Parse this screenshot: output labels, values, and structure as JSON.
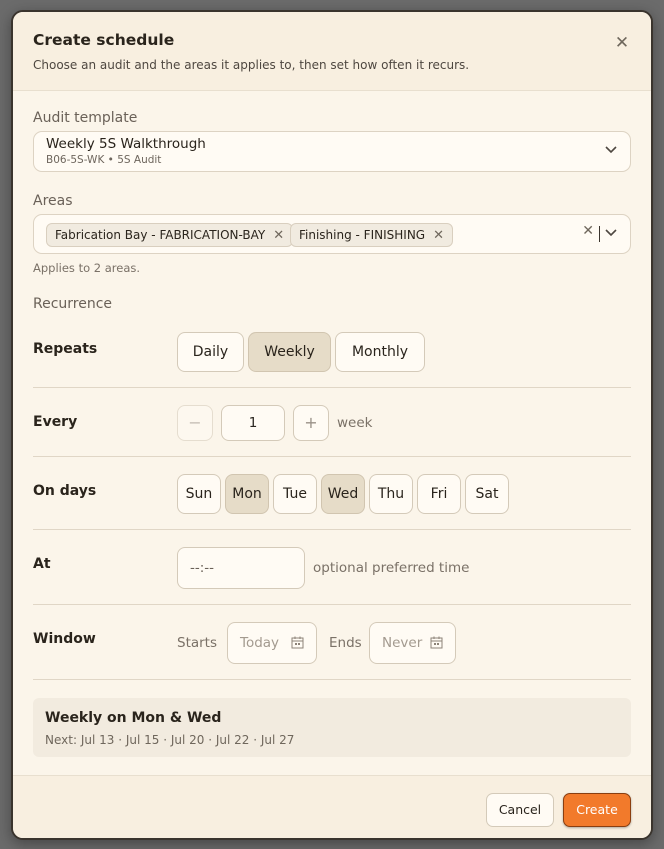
{
  "dialog": {
    "title": "Create schedule",
    "subtitle": "Choose an audit and the areas it applies to, then set how often it recurs.",
    "close_glyph": "✕"
  },
  "audit_template": {
    "label": "Audit template",
    "selected_name": "Weekly 5S Walkthrough",
    "selected_meta": "B06-5S-WK • 5S Audit"
  },
  "areas": {
    "label": "Areas",
    "chips": [
      {
        "label": "Fabrication Bay - FABRICATION-BAY"
      },
      {
        "label": "Finishing - FINISHING"
      }
    ],
    "remove_glyph": "✕",
    "clear_glyph": "✕",
    "hint": "Applies to 2 areas."
  },
  "recurrence": {
    "section_label": "Recurrence",
    "repeats": {
      "label": "Repeats",
      "options": [
        {
          "label": "Daily",
          "active": false
        },
        {
          "label": "Weekly",
          "active": true
        },
        {
          "label": "Monthly",
          "active": false
        }
      ]
    },
    "every": {
      "label": "Every",
      "value": "1",
      "unit": "week",
      "minus_glyph": "−",
      "plus_glyph": "+"
    },
    "on_days": {
      "label": "On days",
      "days": [
        {
          "label": "Sun",
          "active": false
        },
        {
          "label": "Mon",
          "active": true
        },
        {
          "label": "Tue",
          "active": false
        },
        {
          "label": "Wed",
          "active": true
        },
        {
          "label": "Thu",
          "active": false
        },
        {
          "label": "Fri",
          "active": false
        },
        {
          "label": "Sat",
          "active": false
        }
      ]
    },
    "at": {
      "label": "At",
      "placeholder": "--:--",
      "hint": "optional preferred time"
    },
    "window": {
      "label": "Window",
      "starts_label": "Starts",
      "starts_placeholder": "Today",
      "ends_label": "Ends",
      "ends_placeholder": "Never"
    }
  },
  "summary": {
    "title": "Weekly on Mon & Wed",
    "next": "Next: Jul 13 · Jul 15 · Jul 20 · Jul 22 · Jul 27"
  },
  "footer": {
    "cancel_label": "Cancel",
    "create_label": "Create"
  },
  "colors": {
    "accent": "#f27a2b",
    "active_option": "#e6dcc8",
    "background": "#fbf5ea"
  }
}
